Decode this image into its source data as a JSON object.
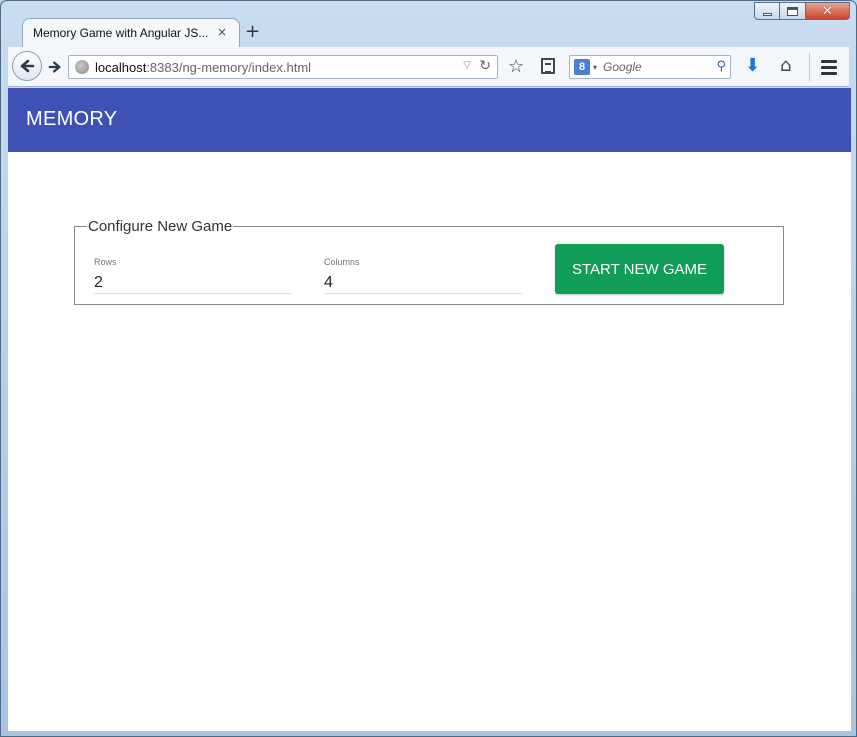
{
  "browser": {
    "tab_title": "Memory Game with Angular JS...",
    "tab_close": "×",
    "new_tab": "+",
    "url_host": "localhost",
    "url_rest": ":8383/ng-memory/index.html",
    "search_engine_glyph": "8",
    "search_placeholder": "Google",
    "icons": [
      "back-arrow-icon",
      "forward-arrow-icon",
      "globe-icon",
      "reload-icon",
      "bookmark-star-icon",
      "reading-list-icon",
      "google-search-icon",
      "magnifier-icon",
      "download-arrow-icon",
      "home-icon",
      "hamburger-menu-icon"
    ]
  },
  "app": {
    "title": "MEMORY",
    "accent_color": "#3f51b5",
    "config": {
      "legend": "Configure New Game",
      "rows_label": "Rows",
      "rows_value": "2",
      "columns_label": "Columns",
      "columns_value": "4",
      "start_button": "START NEW GAME",
      "start_button_color": "#0f9d58"
    }
  }
}
